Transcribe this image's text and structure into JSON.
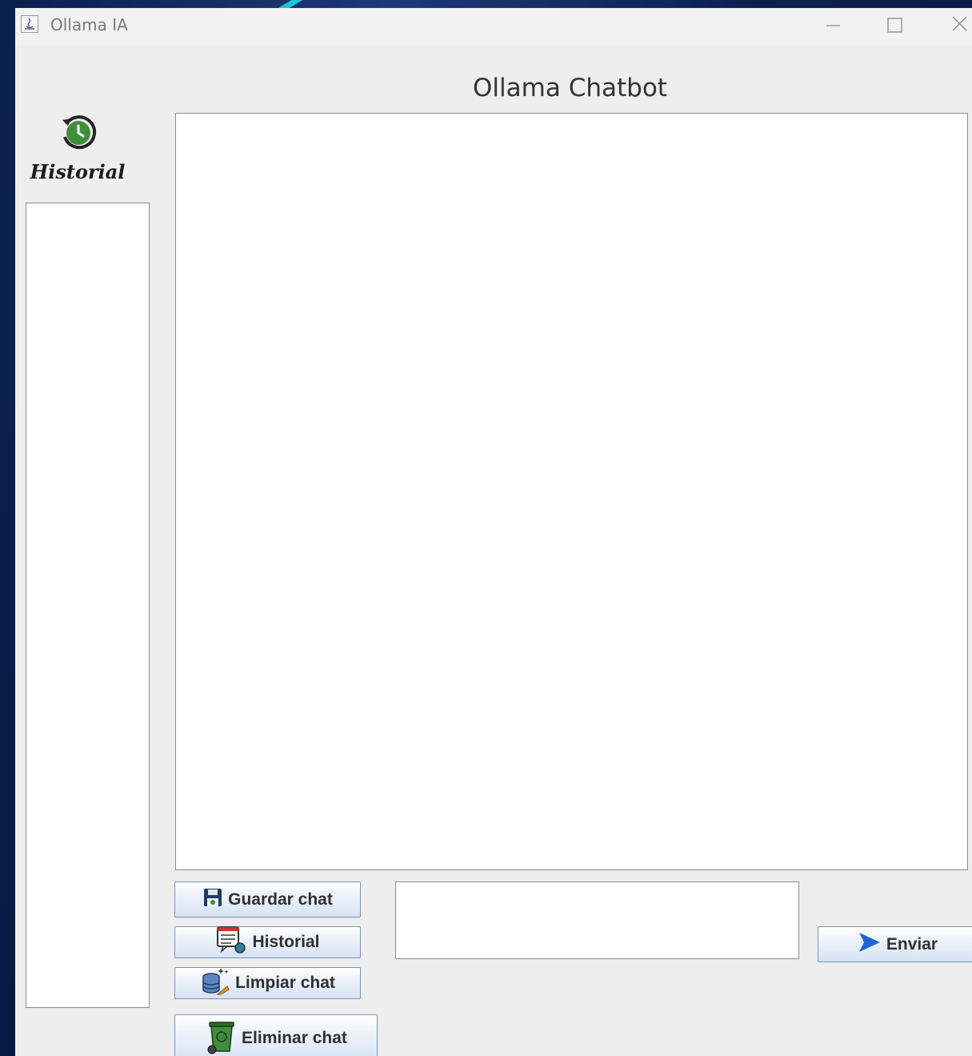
{
  "window": {
    "title": "Ollama IA",
    "controls": [
      "minimize",
      "maximize",
      "close"
    ]
  },
  "header": {
    "title": "Ollama Chatbot"
  },
  "sidebar": {
    "icon": "history-clock-icon",
    "label": "Historial",
    "items": []
  },
  "chat": {
    "messages": []
  },
  "buttons": {
    "save_label": "Guardar chat",
    "history_label": "Historial",
    "clear_label": "Limpiar chat",
    "delete_label": "Eliminar chat",
    "send_label": "Enviar"
  },
  "input": {
    "value": "",
    "placeholder": ""
  },
  "colors": {
    "annotation_arrow": "#1ec4e0",
    "history_icon_green": "#3f8e3a",
    "send_icon_blue": "#1e63d8",
    "desktop_background": "#0b2150"
  }
}
